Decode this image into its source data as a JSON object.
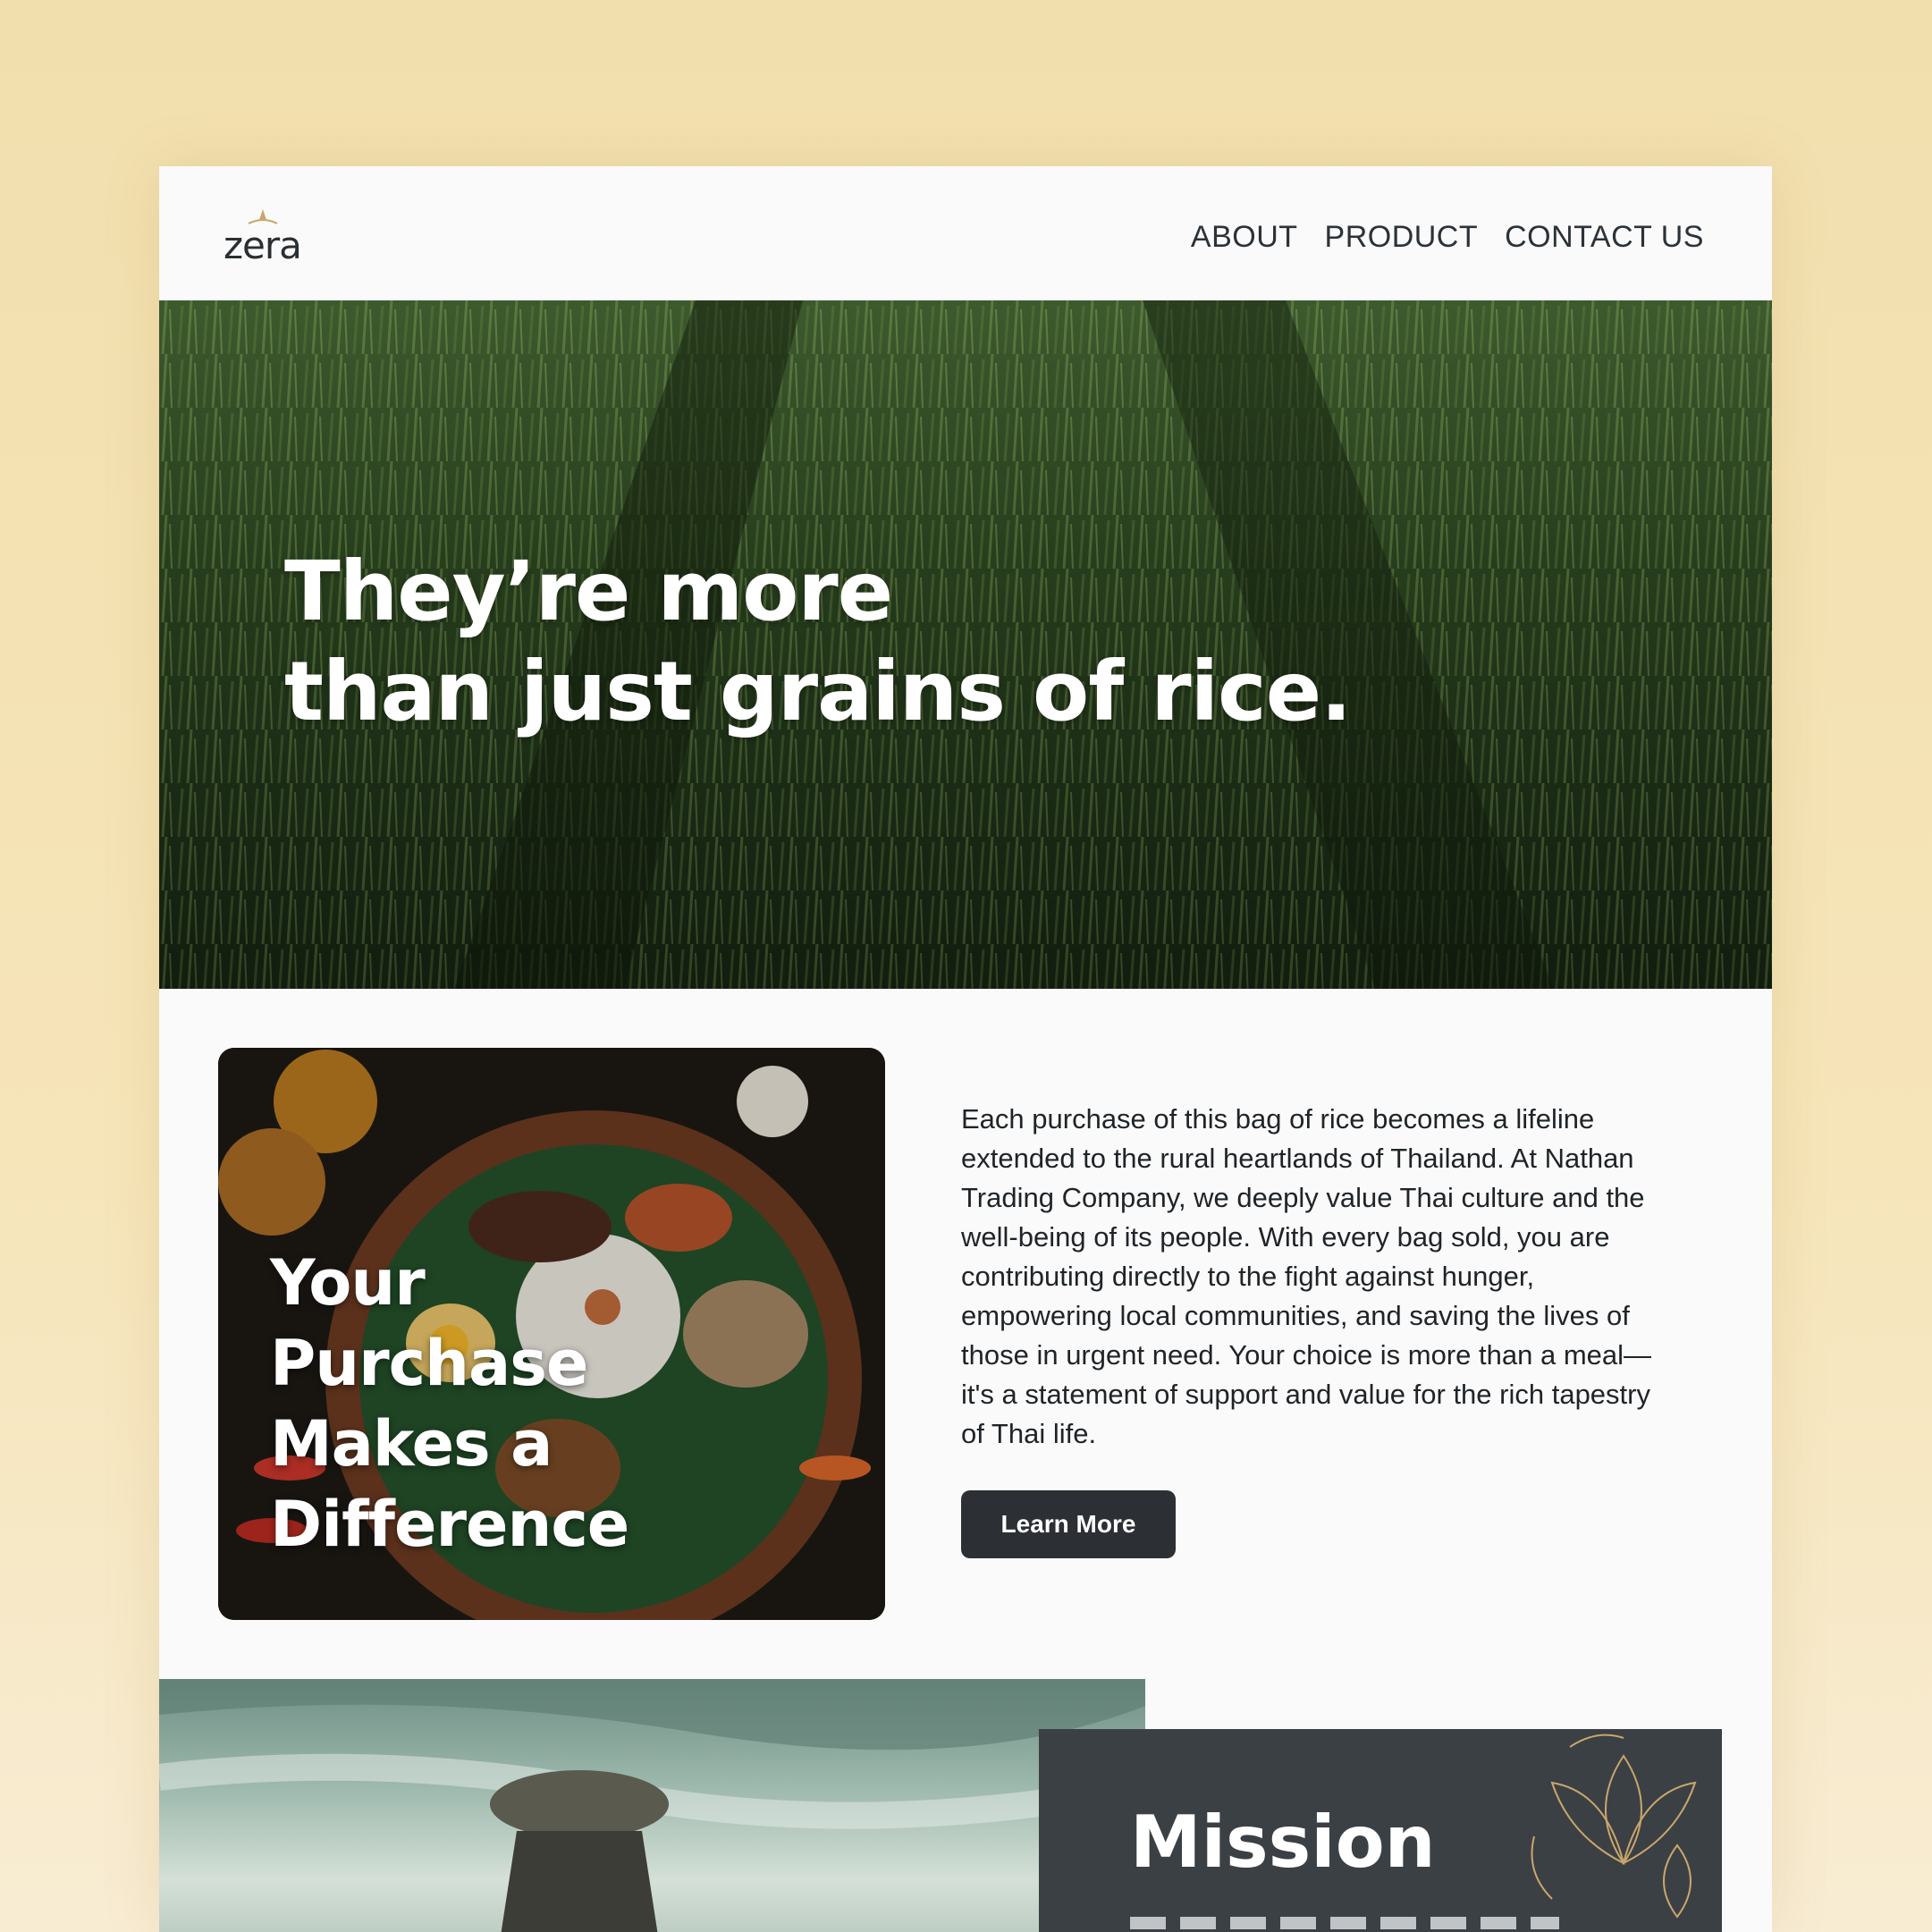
{
  "brand": {
    "name": "zera"
  },
  "nav": {
    "items": [
      "ABOUT",
      "PRODUCT",
      "CONTACT US"
    ]
  },
  "hero": {
    "line1": "They’re more",
    "line2": "than just grains of rice."
  },
  "purchase": {
    "title_lines": [
      "Your",
      "Purchase",
      "Makes a",
      "Difference"
    ],
    "body": "Each purchase of this bag of rice becomes a lifeline extended to the rural heartlands of Thailand. At Nathan Trading Company, we deeply value Thai culture and the well-being of its people. With every bag sold, you are contributing directly to the fight against hunger, empowering local communities, and saving the lives of those in urgent need. Your choice is more than a meal—it's a statement of support and value for the rich tapestry of Thai life.",
    "button_label": "Learn More"
  },
  "mission": {
    "title": "Mission"
  },
  "colors": {
    "background": "#f2dfae",
    "page": "#fafafa",
    "dark": "#2c3034",
    "mission_bg": "#3b4045",
    "gold_accent": "#c9a66b"
  }
}
